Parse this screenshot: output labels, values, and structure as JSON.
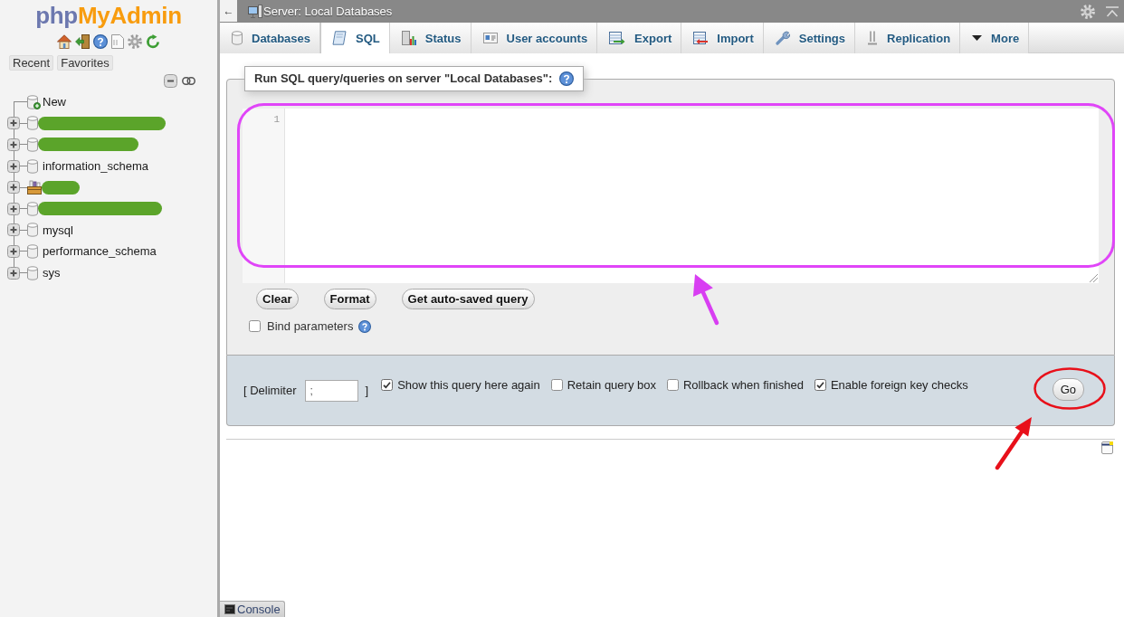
{
  "sidebar": {
    "logo": {
      "prefix": "php",
      "name": "MyAdmin"
    },
    "buttons": [
      "Recent",
      "Favorites"
    ],
    "tree": {
      "new_item": "New",
      "databases": [
        {
          "kind": "masked",
          "expanded": false
        },
        {
          "kind": "masked",
          "expanded": false
        },
        {
          "kind": "database",
          "label": "information_schema",
          "expanded": false
        },
        {
          "kind": "package",
          "expanded": false
        },
        {
          "kind": "masked",
          "expanded": false
        },
        {
          "kind": "database",
          "label": "mysql",
          "expanded": false
        },
        {
          "kind": "database",
          "label": "performance_schema",
          "expanded": false
        },
        {
          "kind": "database",
          "label": "sys",
          "expanded": false
        }
      ]
    }
  },
  "top_bar": {
    "back_button": "←",
    "title": "Server: Local Databases"
  },
  "tabs": [
    {
      "label": "Databases",
      "selected": false
    },
    {
      "label": "SQL",
      "selected": true
    },
    {
      "label": "Status",
      "selected": false
    },
    {
      "label": "User accounts",
      "selected": false
    },
    {
      "label": "Export",
      "selected": false
    },
    {
      "label": "Import",
      "selected": false
    },
    {
      "label": "Settings",
      "selected": false
    },
    {
      "label": "Replication",
      "selected": false
    },
    {
      "label": "More",
      "selected": false
    }
  ],
  "sql_panel": {
    "legend": "Run SQL query/queries on server \"Local Databases\":",
    "editor": {
      "line_numbers": [
        "1"
      ]
    },
    "buttons": [
      "Clear",
      "Format",
      "Get auto-saved query"
    ],
    "bind_parameters": {
      "label": "Bind parameters",
      "checked": false
    }
  },
  "footer": {
    "delimiter": {
      "label": "[ Delimiter",
      "value": ";",
      "closing": "]"
    },
    "options": [
      {
        "label": "Show this query here again",
        "checked": true
      },
      {
        "label": "Retain query box",
        "checked": false
      },
      {
        "label": "Rollback when finished",
        "checked": false
      },
      {
        "label": "Enable foreign key checks",
        "checked": true
      }
    ],
    "go_button": "Go"
  },
  "console": {
    "label": "Console"
  }
}
